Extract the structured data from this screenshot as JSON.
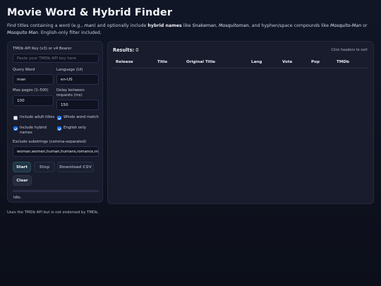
{
  "header": {
    "title": "Movie Word & Hybrid Finder",
    "subtitle": {
      "p1": "Find titles containing a word (e.g., ",
      "p1_italic": "man",
      "p2": ") and optionally include ",
      "p2_bold": "hybrid names",
      "p3": " like ",
      "ex1": "Snakeman",
      "p4": ", ",
      "ex2": "Mosquitoman",
      "p5": ", and hyphen/space compounds like ",
      "ex3": "Mosquito-Man",
      "p6": " or ",
      "ex4": "Mosquito Man",
      "p7": ". English-only filter included."
    }
  },
  "form": {
    "api_key_label": "TMDb API Key (v3) or v4 Bearer",
    "api_key_placeholder": "Paste your TMDb API key here",
    "api_key_value": "",
    "query_label": "Query Word",
    "query_value": "man",
    "language_label": "Language (UI)",
    "language_value": "en-US",
    "max_pages_label": "Max pages (1–500)",
    "max_pages_value": "100",
    "delay_label": "Delay between requests (ms)",
    "delay_value": "150",
    "include_adult_label": "Include adult titles",
    "include_adult_checked": false,
    "whole_word_label": "Whole word match",
    "whole_word_checked": true,
    "include_hybrid_label": "Include hybrid names",
    "include_hybrid_checked": true,
    "english_only_label": "English only",
    "english_only_checked": true,
    "exclude_label": "Exclude substrings (comma-separated)",
    "exclude_value": "woman,women,human,humans,romance,manga"
  },
  "buttons": {
    "start": "Start",
    "stop": "Stop",
    "download": "Download CSV",
    "clear": "Clear"
  },
  "status": {
    "progress": 0,
    "text": "Idle."
  },
  "results": {
    "label": "Results:",
    "count": "0",
    "hint": "Click headers to sort",
    "columns": [
      "Release",
      "Title",
      "Original Title",
      "Lang",
      "Vote",
      "Pop",
      "TMDb"
    ]
  },
  "footer": {
    "text": "Uses the TMDb API but is not endorsed by TMDb."
  },
  "colors": {
    "background": "#0f1320",
    "panel": "#181c2c",
    "checkbox_accent": "#1d6ff2",
    "start_button": "#203445"
  }
}
